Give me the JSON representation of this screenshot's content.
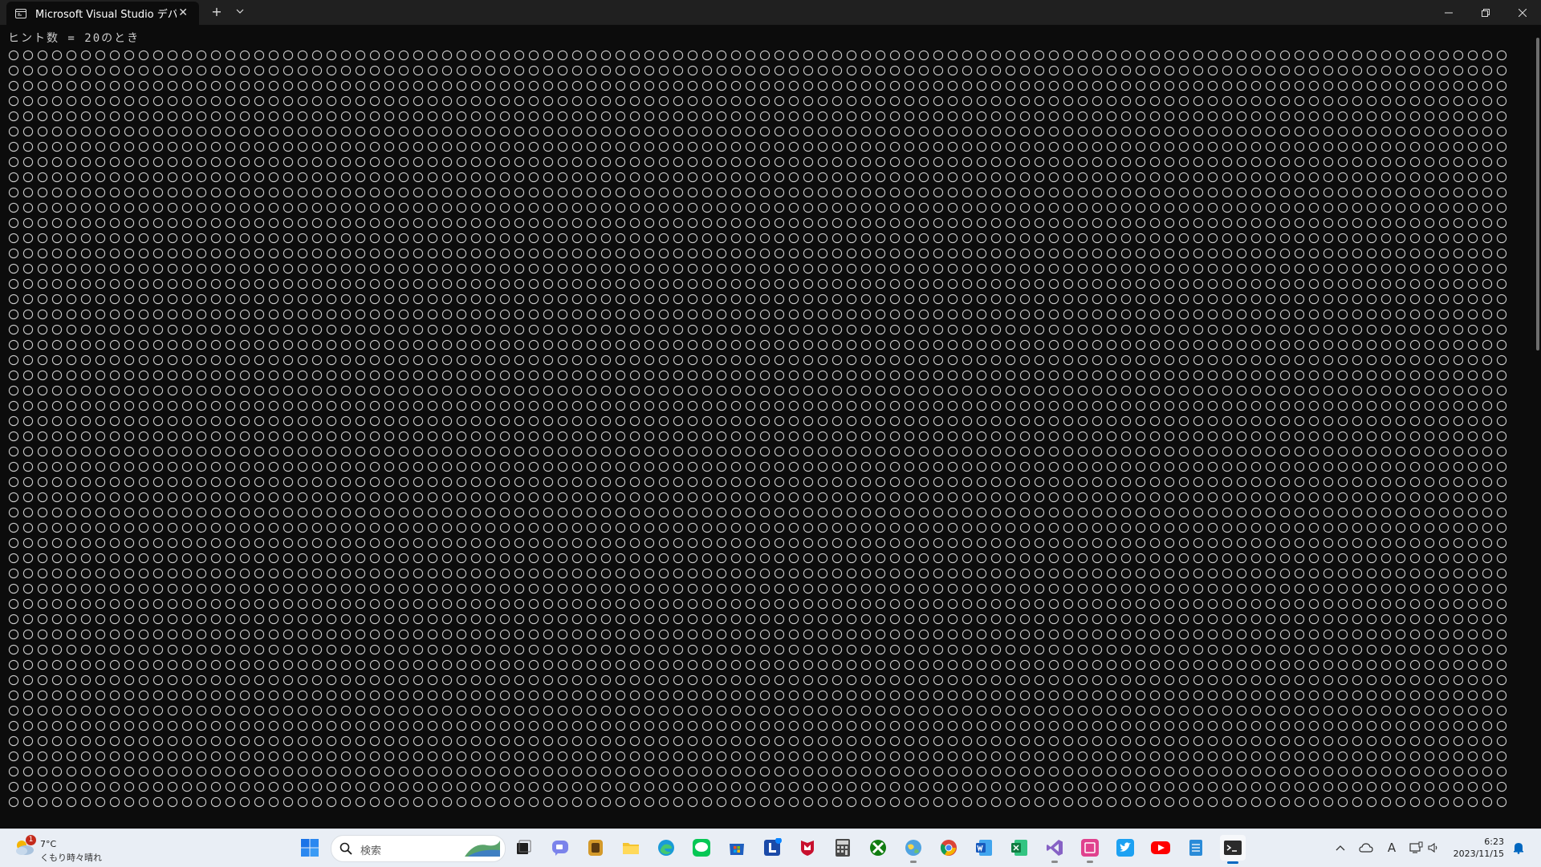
{
  "window": {
    "tab_title": "Microsoft Visual Studio デバッグ",
    "new_tab_label": "+",
    "tab_menu_label": "⌄"
  },
  "console": {
    "header_line": "ヒント数 = 20のとき",
    "grid_glyph": "○",
    "grid_rows": 50,
    "grid_cols": 104
  },
  "taskbar": {
    "weather": {
      "badge": "1",
      "temperature": "7°C",
      "description": "くもり時々晴れ"
    },
    "search": {
      "placeholder": "検索"
    },
    "apps": [
      {
        "icon": "windows-start-icon",
        "label": "スタート",
        "running": false
      },
      {
        "icon": "task-view-icon",
        "label": "タスク ビュー",
        "running": false
      },
      {
        "icon": "teams-chat-icon",
        "label": "チャット",
        "running": false
      },
      {
        "icon": "game-app-icon",
        "label": "ゲーム",
        "running": false
      },
      {
        "icon": "file-explorer-icon",
        "label": "エクスプローラー",
        "running": false
      },
      {
        "icon": "edge-browser-icon",
        "label": "Microsoft Edge",
        "running": false
      },
      {
        "icon": "line-app-icon",
        "label": "LINE",
        "running": false
      },
      {
        "icon": "microsoft-store-icon",
        "label": "Microsoft Store",
        "running": false
      },
      {
        "icon": "l-app-icon",
        "label": "L",
        "running": false,
        "badge": "1"
      },
      {
        "icon": "mcafee-icon",
        "label": "McAfee",
        "running": false
      },
      {
        "icon": "calculator-icon",
        "label": "電卓",
        "running": false
      },
      {
        "icon": "xbox-icon",
        "label": "Xbox",
        "running": false
      },
      {
        "icon": "globe-app-icon",
        "label": "ブラウザー",
        "running": true
      },
      {
        "icon": "chrome-icon",
        "label": "Google Chrome",
        "running": false
      },
      {
        "icon": "word-icon",
        "label": "Word",
        "running": false
      },
      {
        "icon": "excel-icon",
        "label": "Excel",
        "running": false
      },
      {
        "icon": "visual-studio-icon",
        "label": "Visual Studio",
        "running": true
      },
      {
        "icon": "pdf-app-icon",
        "label": "PDF",
        "running": true
      },
      {
        "icon": "twitter-icon",
        "label": "Twitter",
        "running": false
      },
      {
        "icon": "youtube-icon",
        "label": "YouTube",
        "running": false
      },
      {
        "icon": "notepad-icon",
        "label": "メモ帳",
        "running": false
      },
      {
        "icon": "terminal-icon",
        "label": "ターミナル",
        "running": true,
        "active": true
      }
    ],
    "tray": {
      "ime_label": "A"
    },
    "clock": {
      "time": "6:23",
      "date": "2023/11/15"
    }
  },
  "colors": {
    "console_bg": "#0c0c0c",
    "console_fg": "#cccccc",
    "titlebar_bg": "#202020",
    "taskbar_bg": "#e9eef5",
    "accent": "#0067c0"
  }
}
